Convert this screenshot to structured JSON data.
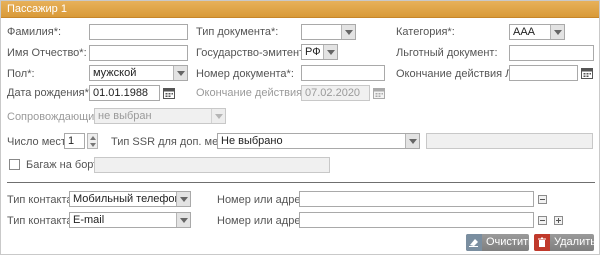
{
  "panel": {
    "title": "Пассажир 1"
  },
  "fields": {
    "surname": {
      "label": "Фамилия*:",
      "value": ""
    },
    "first_middle": {
      "label": "Имя Отчество*:",
      "value": ""
    },
    "gender": {
      "label": "Пол*:",
      "value": "мужской"
    },
    "birth_date": {
      "label": "Дата рождения*:",
      "value": "01.01.1988"
    },
    "doc_type": {
      "label": "Тип документа*:",
      "value": ""
    },
    "issuing_state": {
      "label": "Государство-эмитент*:",
      "value": "РФ"
    },
    "doc_number": {
      "label": "Номер документа*:",
      "value": ""
    },
    "expiry": {
      "label": "Окончание действия:",
      "value": "07.02.2020"
    },
    "category": {
      "label": "Категория*:",
      "value": "AAA"
    },
    "benefit_doc": {
      "label": "Льготный документ:",
      "value": ""
    },
    "benefit_expiry": {
      "label": "Окончание действия ЛД:",
      "value": ""
    },
    "companion": {
      "label": "Сопровождающий:",
      "value": "не выбран"
    },
    "seats": {
      "label": "Число мест:",
      "value": "1"
    },
    "ssr_type": {
      "label": "Тип SSR для доп. мест:",
      "value": "Не выбрано",
      "extra_value": ""
    },
    "baggage": {
      "label": "Багаж на борту",
      "value": ""
    }
  },
  "contacts": [
    {
      "type_label": "Тип контакта:",
      "type_value": "Мобильный телефон",
      "addr_label": "Номер или адрес:",
      "addr_value": ""
    },
    {
      "type_label": "Тип контакта:",
      "type_value": "E-mail",
      "addr_label": "Номер или адрес:",
      "addr_value": ""
    }
  ],
  "buttons": {
    "clear": {
      "label": "Очистить",
      "icon": "eraser-icon"
    },
    "delete": {
      "label": "Удалить",
      "icon": "trash-icon",
      "icon_color": "#c0392b"
    }
  },
  "colors": {
    "header": "#dea140",
    "button": "#8a8a8a",
    "delete_accent": "#c0392b"
  }
}
